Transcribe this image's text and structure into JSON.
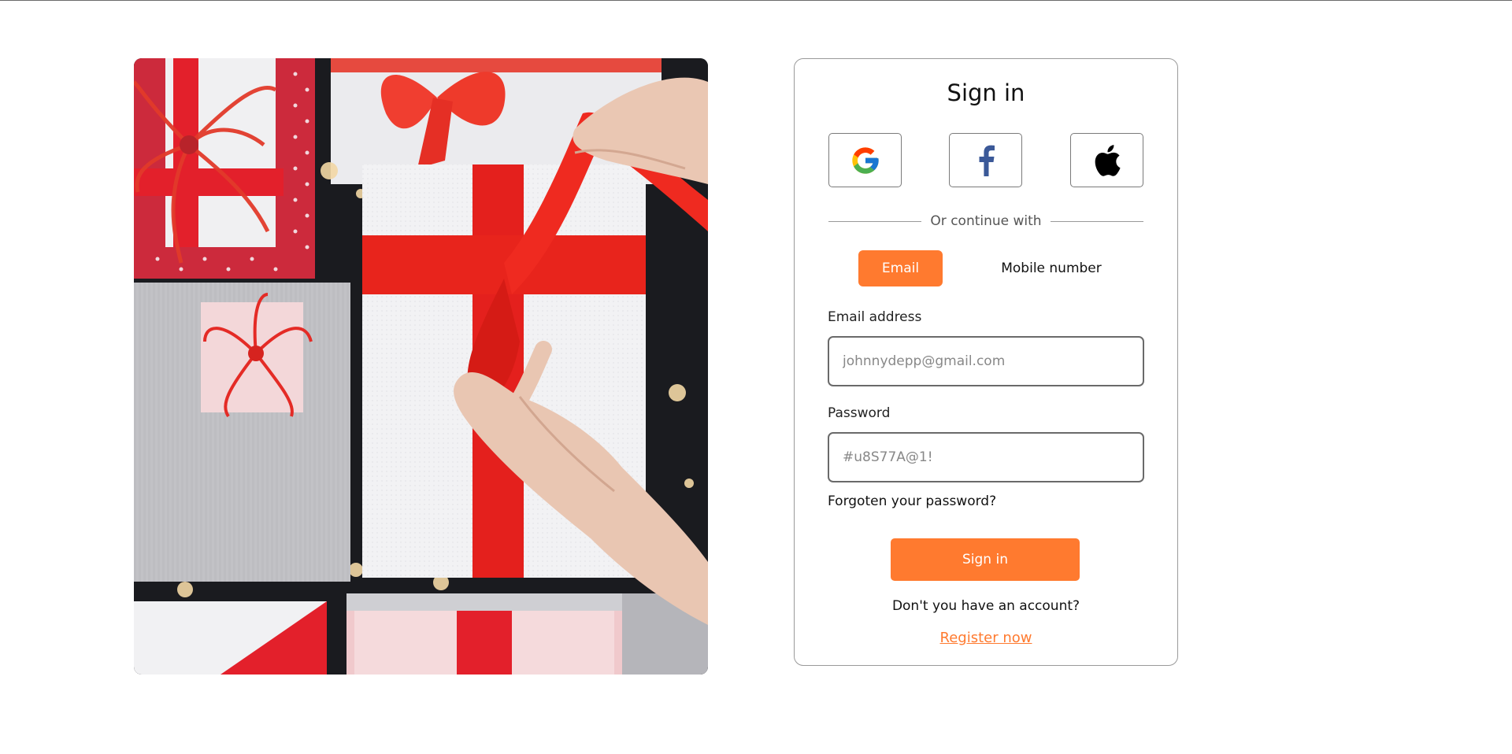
{
  "page": {
    "title": "Sign in"
  },
  "social": [
    {
      "name": "google-icon"
    },
    {
      "name": "facebook-icon"
    },
    {
      "name": "apple-icon"
    }
  ],
  "divider_text": "Or continue with",
  "tabs": {
    "email": "Email",
    "mobile": "Mobile number",
    "active": "Email"
  },
  "form": {
    "email_label": "Email address",
    "email_placeholder": "johnnydepp@gmail.com",
    "password_label": "Password",
    "password_placeholder": "#u8S77A@1!",
    "forgot_label": "Forgoten your password?",
    "submit_label": "Sign in"
  },
  "footer": {
    "no_account": "Don't you have an account?",
    "register_label": "Register now"
  },
  "colors": {
    "accent": "#ff7a2f",
    "ribbon": "#e8241c",
    "facebook": "#3b5998"
  }
}
